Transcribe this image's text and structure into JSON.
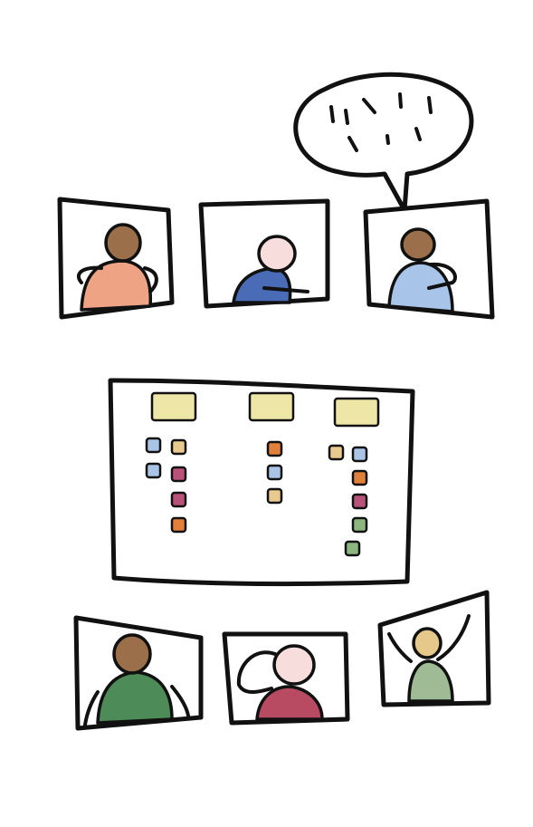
{
  "scene": "video-call-collaboration-sketch",
  "colors": {
    "ink": "#111111",
    "header_note": "#EDE6A6",
    "note_blue": "#A9C4E4",
    "note_yellow": "#E8C98E",
    "note_magenta": "#B8527A",
    "note_orange": "#E0803A",
    "note_green": "#8DB580",
    "skin_brown": "#9B6F4A",
    "skin_light": "#F7DEDD",
    "skin_gold": "#E6C98A",
    "shirt_salmon": "#EFA385",
    "shirt_navy": "#4A6BB5",
    "shirt_lightblue": "#A8C4E8",
    "shirt_green": "#4D8B58",
    "shirt_crimson": "#B84A62",
    "shirt_sage": "#9FBB96"
  },
  "top_participants": [
    {
      "id": "participant-1",
      "skin": "skin_brown",
      "shirt": "shirt_salmon"
    },
    {
      "id": "participant-2",
      "skin": "skin_light",
      "shirt": "shirt_navy"
    },
    {
      "id": "participant-3",
      "skin": "skin_brown",
      "shirt": "shirt_lightblue",
      "speaking": true
    }
  ],
  "bottom_participants": [
    {
      "id": "participant-4",
      "skin": "skin_brown",
      "shirt": "shirt_green"
    },
    {
      "id": "participant-5",
      "skin": "skin_light",
      "shirt": "shirt_crimson"
    },
    {
      "id": "participant-6",
      "skin": "skin_gold",
      "shirt": "shirt_sage",
      "arms_raised": true
    }
  ],
  "board": {
    "columns": [
      {
        "notes": [
          "note_blue",
          "note_yellow",
          "note_blue",
          "note_magenta",
          "note_magenta",
          "note_orange"
        ]
      },
      {
        "notes": [
          "note_orange",
          "note_blue",
          "note_yellow"
        ]
      },
      {
        "notes": [
          "note_yellow",
          "note_blue",
          "note_orange",
          "note_magenta",
          "note_green",
          "note_green"
        ]
      }
    ]
  }
}
